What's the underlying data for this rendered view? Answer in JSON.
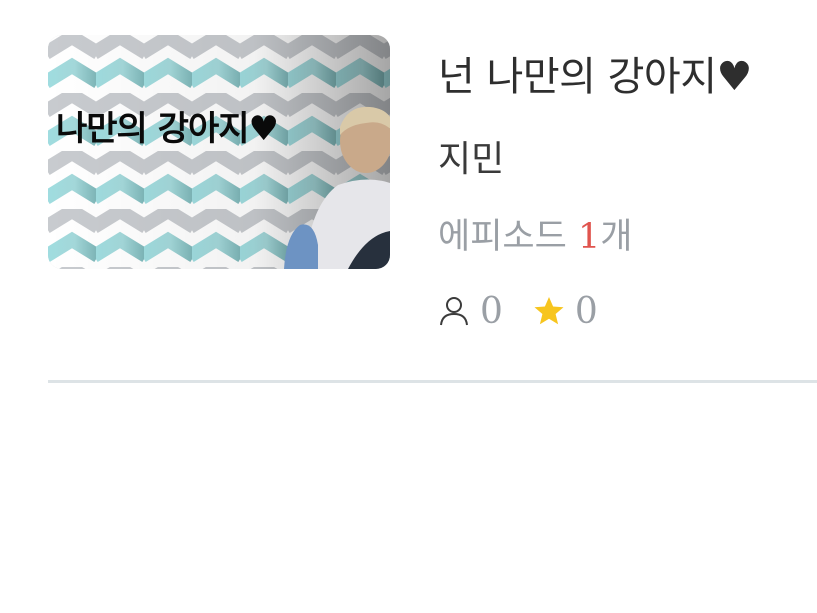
{
  "story": {
    "thumbnail_caption": "나만의 강아지♥",
    "title": "넌 나만의 강아지♥",
    "author": "지민",
    "episodes": {
      "prefix": "에피소드 ",
      "count": "1",
      "suffix": "개"
    },
    "stats": {
      "views": "0",
      "stars": "0"
    }
  },
  "icons": {
    "views": "person-icon",
    "stars": "star-icon"
  },
  "colors": {
    "title": "#2e2e2e",
    "muted": "#9a9fa5",
    "episode_count_accent": "#e0544e",
    "star": "#f7c51e",
    "divider": "#dde3e6"
  }
}
